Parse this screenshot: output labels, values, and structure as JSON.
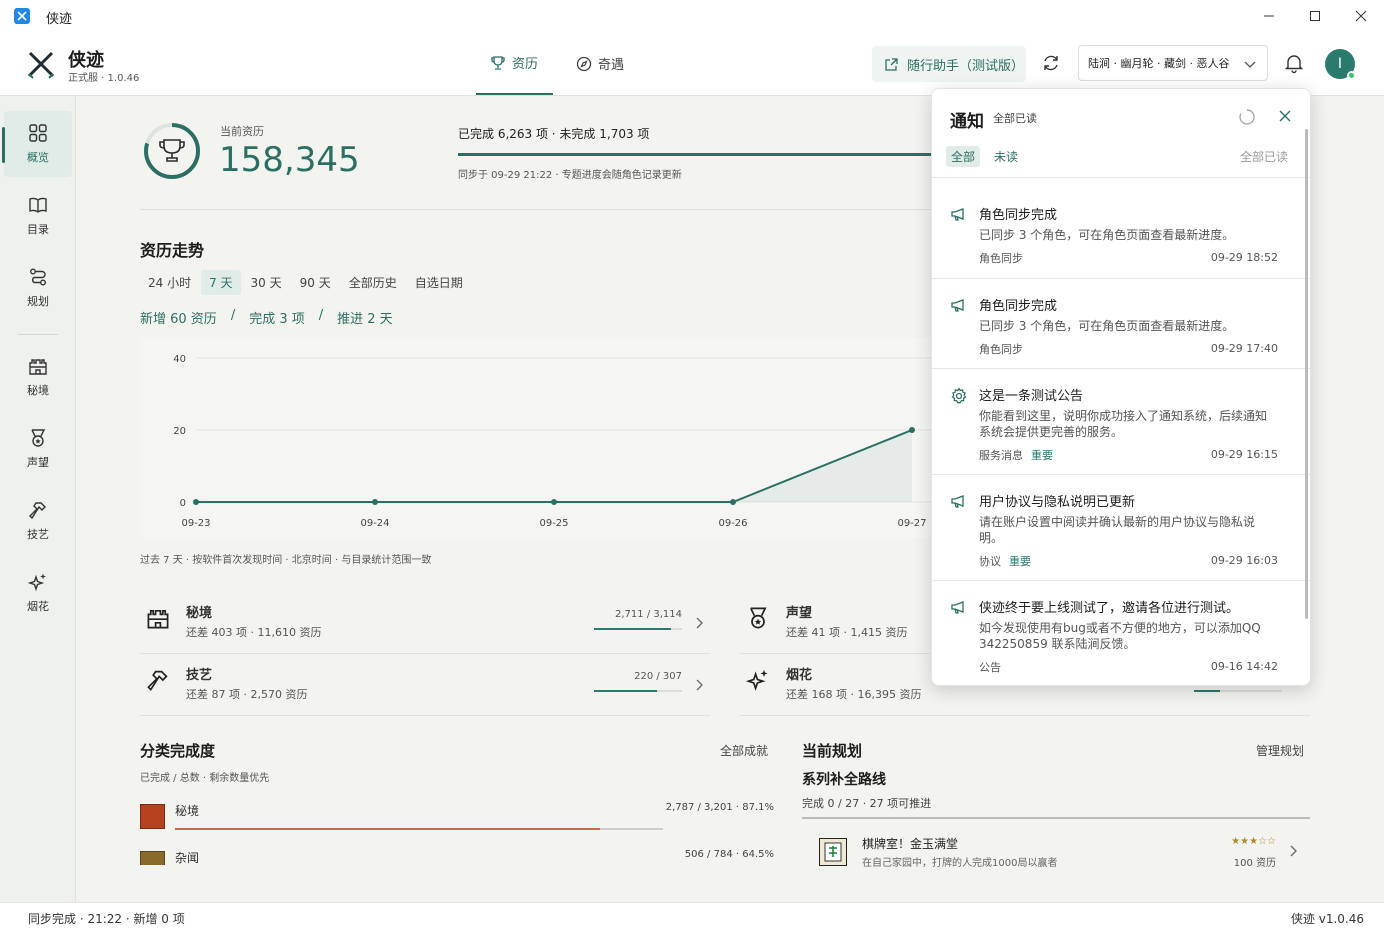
{
  "window": {
    "title": "侠迹"
  },
  "header": {
    "app_name": "侠迹",
    "version": "正式服 · 1.0.46",
    "tabs": [
      {
        "label": "资历",
        "icon": "trophy-icon",
        "active": true
      },
      {
        "label": "奇遇",
        "icon": "compass-icon",
        "active": false
      }
    ],
    "helper_label": "随行助手（测试版）",
    "character": "陆涧 · 幽月轮 · 藏剑 · 恶人谷",
    "avatar_letter": "I"
  },
  "sidebar": {
    "items": [
      {
        "label": "概览",
        "icon": "dashboard-icon",
        "active": true
      },
      {
        "label": "目录",
        "icon": "book-icon"
      },
      {
        "label": "规划",
        "icon": "route-icon"
      },
      {
        "label": "秘境",
        "icon": "castle-icon"
      },
      {
        "label": "声望",
        "icon": "medal-icon"
      },
      {
        "label": "技艺",
        "icon": "hammer-icon"
      },
      {
        "label": "烟花",
        "icon": "sparkle-icon"
      }
    ]
  },
  "summary": {
    "current_label": "当前资历",
    "current_value": "158,345",
    "done_text": "已完成 6,263 项 · 未完成 1,703 项",
    "sync_text": "同步于 09-29 21:22 · 专题进度会随角色记录更新"
  },
  "trend": {
    "title": "资历走势",
    "ranges": [
      "24 小时",
      "7 天",
      "30 天",
      "90 天",
      "全部历史",
      "自选日期"
    ],
    "active_range": "7 天",
    "stats": [
      "新增 60 资历",
      "完成 3 项",
      "推进 2 天"
    ],
    "stat_sep": "/",
    "note": "过去 7 天 · 按软件首次发现时间 · 北京时间 · 与目录统计范围一致"
  },
  "chart_data": {
    "type": "area",
    "categories": [
      "09-23",
      "09-24",
      "09-25",
      "09-26",
      "09-27"
    ],
    "values": [
      0,
      0,
      0,
      0,
      20
    ],
    "yticks": [
      "40",
      "20",
      "0"
    ],
    "ylim": [
      0,
      40
    ],
    "grid": true,
    "color": "#2b6f63"
  },
  "categories": [
    {
      "name": "秘境",
      "sub": "还差 403 项 · 11,610 资历",
      "progress": "2,711 / 3,114",
      "ratio": 0.87,
      "icon": "castle-icon"
    },
    {
      "name": "声望",
      "sub": "还差 41 项 · 1,415 资历",
      "icon": "medal-icon"
    },
    {
      "name": "技艺",
      "sub": "还差 87 项 · 2,570 资历",
      "progress": "220 / 307",
      "ratio": 0.72,
      "icon": "hammer-icon"
    },
    {
      "name": "烟花",
      "sub": "还差 168 项 · 16,395 资历",
      "ratio": 0.3,
      "icon": "sparkle-icon"
    }
  ],
  "completion": {
    "title": "分类完成度",
    "link": "全部成就",
    "note": "已完成 / 总数 · 剩余数量优先",
    "rows": [
      {
        "name": "秘境",
        "value": "2,787 / 3,201 · 87.1%",
        "ratio": 0.871
      },
      {
        "name": "杂闻",
        "value": "506 / 784 · 64.5%",
        "ratio": 0.645
      }
    ]
  },
  "plan": {
    "title": "当前规划",
    "link": "管理规划",
    "name": "系列补全路线",
    "sub": "完成 0 / 27 · 27 项可推进",
    "item_name": "棋牌室！金玉满堂",
    "item_stars": "★★★☆☆",
    "item_cut": "在自己家园中，打牌的人完成1000局以赢者",
    "item_reward": "100 资历"
  },
  "statusbar": {
    "left": "同步完成 · 21:22 · 新增 0 项",
    "right": "侠迹 v1.0.46"
  },
  "notifications": {
    "title": "通知",
    "subtitle": "全部已读",
    "tabs": [
      "全部",
      "未读"
    ],
    "mark_all": "全部已读",
    "items": [
      {
        "icon": "megaphone-icon",
        "title": "角色同步完成",
        "body": "已同步 3 个角色，可在角色页面查看最新进度。",
        "tag": "角色同步",
        "important": "",
        "time": "09-29 18:52"
      },
      {
        "icon": "megaphone-icon",
        "title": "角色同步完成",
        "body": "已同步 3 个角色，可在角色页面查看最新进度。",
        "tag": "角色同步",
        "important": "",
        "time": "09-29 17:40"
      },
      {
        "icon": "gear-icon",
        "title": "这是一条测试公告",
        "body": "你能看到这里，说明你成功接入了通知系统，后续通知系统会提供更完善的服务。",
        "tag": "服务消息",
        "important": "重要",
        "time": "09-29 16:15"
      },
      {
        "icon": "megaphone-icon",
        "title": "用户协议与隐私说明已更新",
        "body": "请在账户设置中阅读并确认最新的用户协议与隐私说明。",
        "tag": "协议",
        "important": "重要",
        "time": "09-29 16:03"
      },
      {
        "icon": "megaphone-icon",
        "title": "侠迹终于要上线测试了，邀请各位进行测试。",
        "body": "如今发现使用有bug或者不方便的地方，可以添加QQ 342250859 联系陆涧反馈。",
        "tag": "公告",
        "important": "",
        "time": "09-16 14:42"
      }
    ]
  }
}
